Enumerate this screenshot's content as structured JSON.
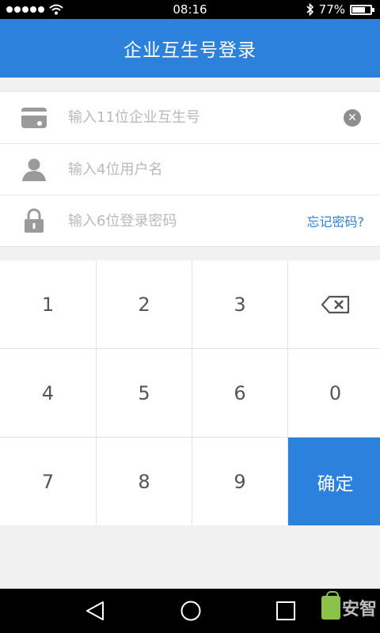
{
  "status_bar": {
    "time": "08:16",
    "battery_text": "77%",
    "battery_level": 0.77,
    "icons": [
      "signal-dots-icon",
      "wifi-icon",
      "bluetooth-icon",
      "battery-icon"
    ]
  },
  "header": {
    "title": "企业互生号登录"
  },
  "form": {
    "company_placeholder": "输入11位企业互生号",
    "username_placeholder": "输入4位用户名",
    "password_placeholder": "输入6位登录密码",
    "forgot_label": "忘记密码?",
    "icons": [
      "card-icon",
      "user-icon",
      "lock-icon",
      "clear-icon"
    ]
  },
  "keypad": {
    "keys": [
      "1",
      "2",
      "3",
      "4",
      "5",
      "6",
      "0",
      "7",
      "8",
      "9"
    ],
    "backspace_icon": "backspace-icon",
    "confirm_label": "确定"
  },
  "nav_bar": {
    "icons": [
      "back-icon",
      "home-icon",
      "recents-icon"
    ]
  },
  "watermark": {
    "text": "安智",
    "icon": "shopping-bag-icon"
  },
  "colors": {
    "accent": "#2b81dc",
    "background": "#f1f1f1"
  }
}
